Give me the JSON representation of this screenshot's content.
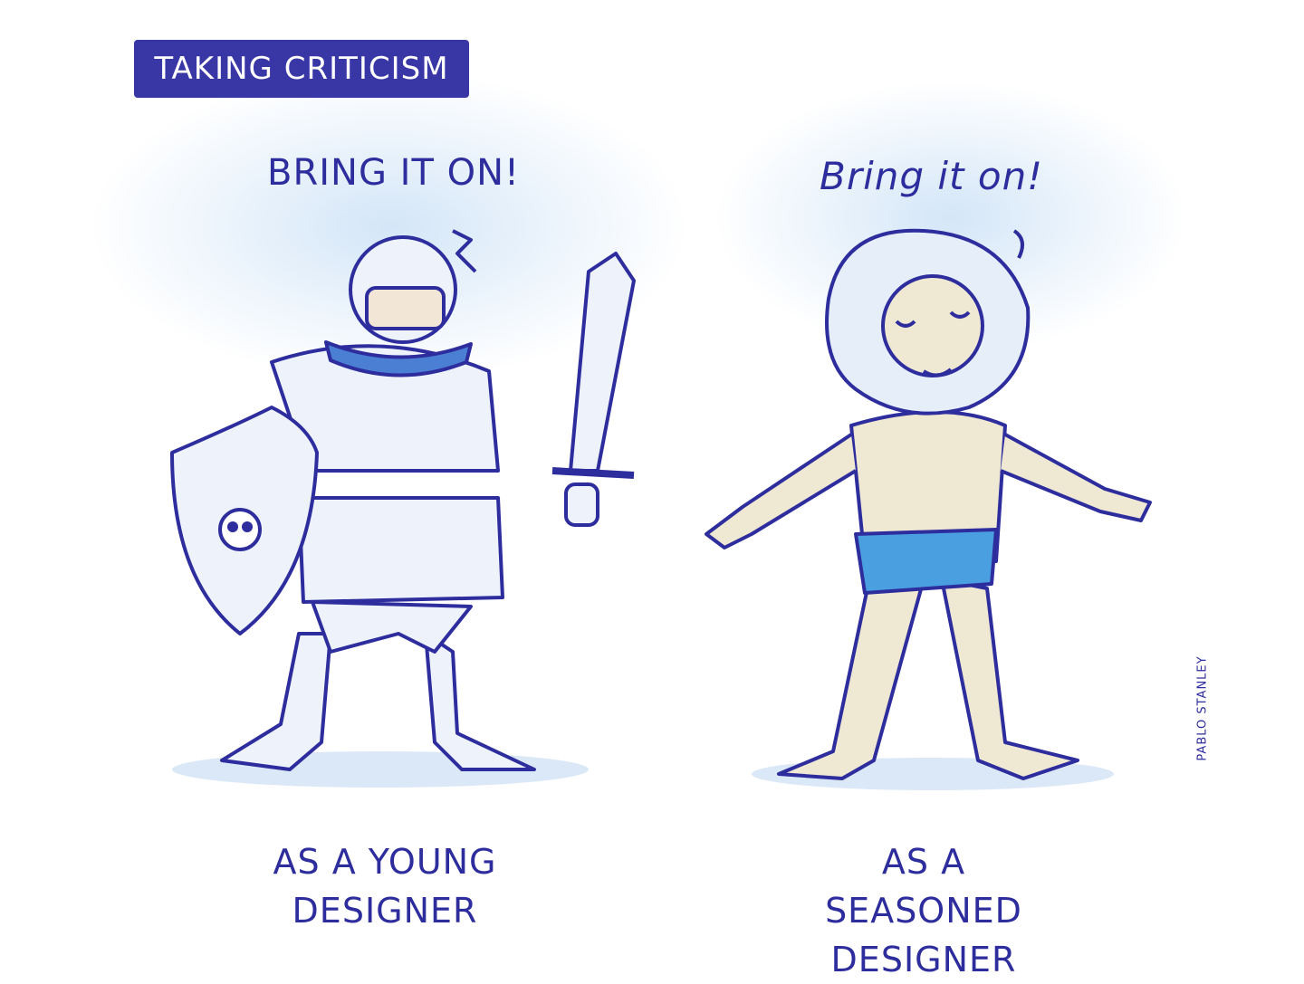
{
  "title": "TAKING CRITICISM",
  "left_panel": {
    "speech": "BRING IT ON!",
    "caption_line1": "AS A YOUNG",
    "caption_line2": "DESIGNER"
  },
  "right_panel": {
    "speech": "Bring it on!",
    "caption_line1": "AS A SEASONED",
    "caption_line2": "DESIGNER"
  },
  "signature": "PABLO STANLEY",
  "colors": {
    "ink": "#2e2d9e",
    "title_bg": "#3936a6",
    "glow": "#cfe3f7",
    "skin": "#efe8d2",
    "cloth": "#4a9fe0",
    "armor": "#e8eef9"
  }
}
